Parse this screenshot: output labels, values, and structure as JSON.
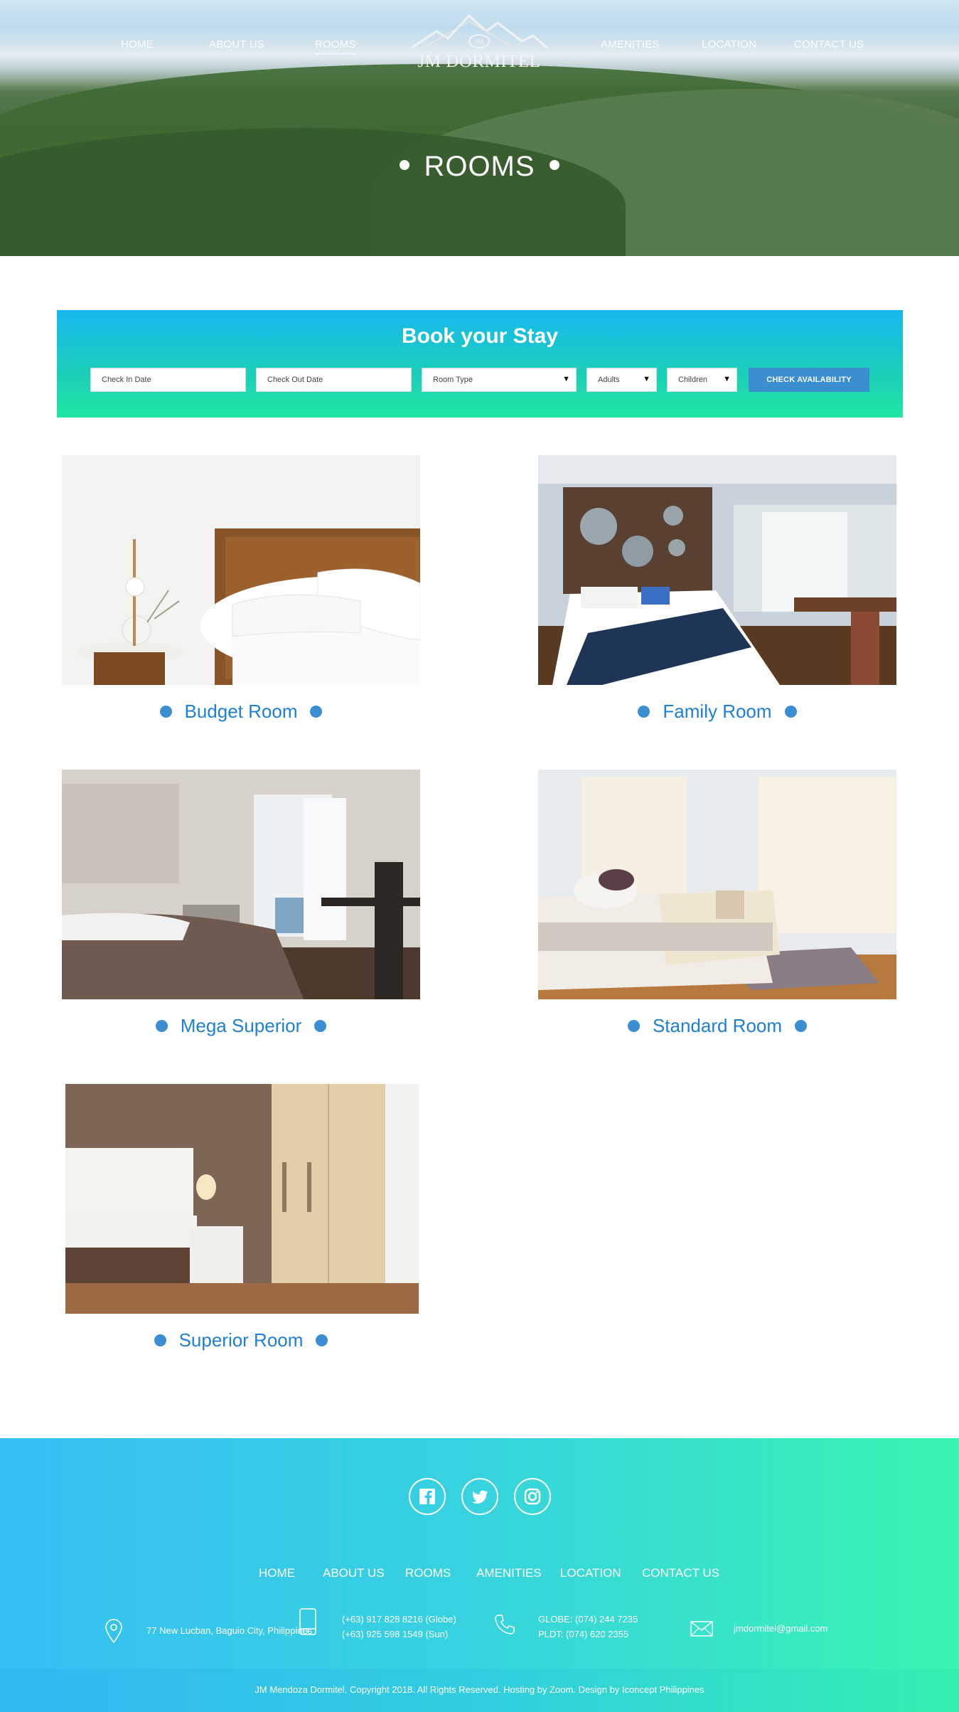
{
  "nav": {
    "items": [
      {
        "label": "HOME"
      },
      {
        "label": "ABOUT US"
      },
      {
        "label": "ROOMS"
      },
      {
        "label": "AMENITIES"
      },
      {
        "label": "LOCATION"
      },
      {
        "label": "CONTACT US"
      }
    ],
    "active": "ROOMS",
    "logo_text": "JM DORMITEL"
  },
  "hero": {
    "title": "ROOMS"
  },
  "booking": {
    "heading": "Book your Stay",
    "check_in_placeholder": "Check In Date",
    "check_out_placeholder": "Check Out Date",
    "room_type": "Room Type",
    "adults": "Adults",
    "children": "Children",
    "button": "CHECK AVAILABILITY"
  },
  "rooms": [
    {
      "name": "Budget Room"
    },
    {
      "name": "Family Room"
    },
    {
      "name": "Mega Superior"
    },
    {
      "name": "Standard Room"
    },
    {
      "name": "Superior Room"
    }
  ],
  "footer": {
    "social": [
      "facebook-icon",
      "twitter-icon",
      "instagram-icon"
    ],
    "nav": [
      "HOME",
      "ABOUT US",
      "ROOMS",
      "AMENITIES",
      "LOCATION",
      "CONTACT US"
    ],
    "address": "77 New Lucban, Baguio City, Philippines",
    "mobile_1": "(+63) 917 828 8216 (Globe)",
    "mobile_2": "(+63) 925 598 1549 (Sun)",
    "phone_1": "GLOBE: (074) 244 7235",
    "phone_2": "PLDT: (074) 620 2355",
    "email": "jmdormitel@gmail.com",
    "copyright": "JM Mendoza Dormitel. Copyright 2018. All Rights Reserved. Hosting by Zoom. Design by Iconcept Philippines"
  }
}
